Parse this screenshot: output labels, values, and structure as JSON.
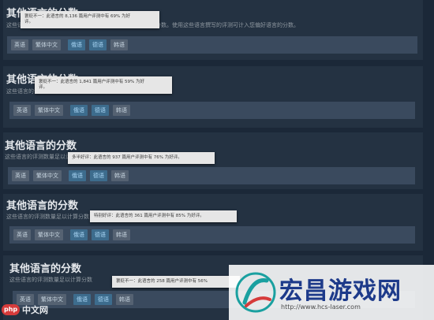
{
  "sections": [
    {
      "title": "其他语言的分数",
      "desc": "这些语言的评测数量足以计算分数，但该分数不计入总体评测分数。使用这些语言撰写的评测可计入您偏好语言的分数。",
      "tags": [
        "英语",
        "繁体中文",
        "俄语",
        "德语",
        "韩语"
      ],
      "tooltip": [
        "褒贬不一：此语言的 8,136 篇用户评测中有 69% 为好",
        "评。"
      ]
    },
    {
      "title": "其他语言的分数",
      "desc": "这些语言的评测数量足以计算分数，但该分数不计入总体评测分数。",
      "tags": [
        "英语",
        "繁体中文",
        "俄语",
        "德语",
        "韩语"
      ],
      "tooltip": [
        "褒贬不一：此语言的 1,841 篇用户评测中有 59% 为好",
        "评。"
      ]
    },
    {
      "title": "其他语言的分数",
      "desc": "这些语言的评测数量足以计算分数",
      "tags": [
        "英语",
        "繁体中文",
        "俄语",
        "德语",
        "韩语"
      ],
      "tooltip": [
        "多半好评：此语言的 937 篇用户评测中有 76% 为好评。"
      ]
    },
    {
      "title": "其他语言的分数",
      "desc": "这些语言的评测数量足以计算分数",
      "tags": [
        "英语",
        "繁体中文",
        "俄语",
        "德语",
        "韩语"
      ],
      "tooltip": [
        "特别好评：此语言的 361 篇用户评测中有 85% 为好评。"
      ]
    },
    {
      "title": "其他语言的分数",
      "desc": "这些语言的评测数量足以计算分数",
      "tags": [
        "英语",
        "繁体中文",
        "俄语",
        "德语",
        "韩语"
      ],
      "tooltip": [
        "褒贬不一：此语言的 258 篇用户评测中有 56%"
      ]
    }
  ],
  "watermark": {
    "brand": "宏昌游戏网",
    "url": "http://www.hcs-laser.com"
  },
  "badge": {
    "php": "php",
    "cn": "中文网"
  },
  "colors": {
    "page_bg": "#1b2838",
    "panel_bg": "#243242",
    "tag_bg": "#556272",
    "tag_blue": "#3d6c8d",
    "tooltip_bg": "#e6e6e6",
    "brand_blue": "#1d3a8a"
  }
}
